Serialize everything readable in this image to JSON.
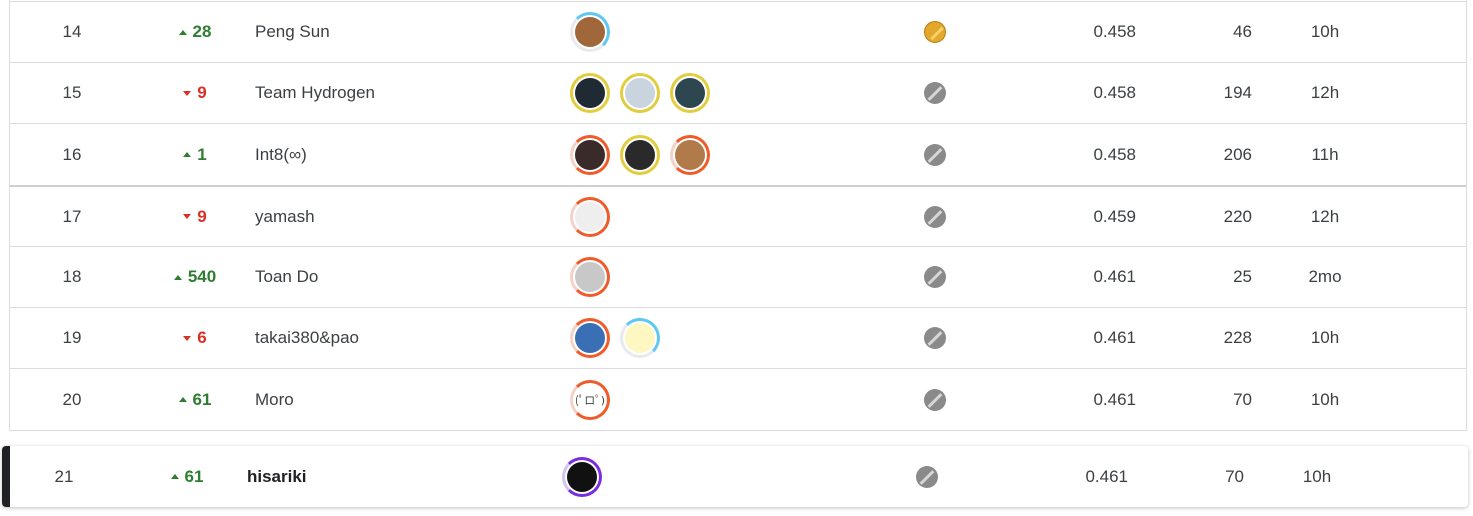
{
  "rows": [
    {
      "rank": "14",
      "dir": "up",
      "delta": "28",
      "name": "Peng Sun",
      "medal": "gold",
      "score": "0.458",
      "entries": "46",
      "last": "10h",
      "avatars": [
        {
          "ring": "r-blue",
          "fill": "#a0683a",
          "name": "avatar-peng-sun"
        }
      ]
    },
    {
      "rank": "15",
      "dir": "down",
      "delta": "9",
      "name": "Team Hydrogen",
      "medal": "silver",
      "score": "0.458",
      "entries": "194",
      "last": "12h",
      "avatars": [
        {
          "ring": "r-gold",
          "fill": "#1f2a33"
        },
        {
          "ring": "r-gold",
          "fill": "#c9d4de"
        },
        {
          "ring": "r-gold",
          "fill": "#2d4650"
        }
      ]
    },
    {
      "rank": "16",
      "dir": "up",
      "delta": "1",
      "name": "Int8(∞)",
      "medal": "silver",
      "score": "0.458",
      "entries": "206",
      "last": "11h",
      "avatars": [
        {
          "ring": "r-orange",
          "fill": "#3a2a2a"
        },
        {
          "ring": "r-gold",
          "fill": "#2a2a2a"
        },
        {
          "ring": "r-orange",
          "fill": "#b07a4a"
        }
      ]
    },
    {
      "rank": "17",
      "dir": "down",
      "delta": "9",
      "name": "yamash",
      "medal": "silver",
      "score": "0.459",
      "entries": "220",
      "last": "12h",
      "avatars": [
        {
          "ring": "r-orange",
          "fill": "#eeeeee"
        }
      ]
    },
    {
      "rank": "18",
      "dir": "up",
      "delta": "540",
      "name": "Toan Do",
      "medal": "silver",
      "score": "0.461",
      "entries": "25",
      "last": "2mo",
      "avatars": [
        {
          "ring": "r-orange",
          "fill": "#c8c8c8"
        }
      ]
    },
    {
      "rank": "19",
      "dir": "down",
      "delta": "6",
      "name": "takai380&pao",
      "medal": "silver",
      "score": "0.461",
      "entries": "228",
      "last": "10h",
      "avatars": [
        {
          "ring": "r-orange",
          "fill": "#3b6fb5"
        },
        {
          "ring": "r-blue",
          "fill": "#fff7c2"
        }
      ]
    },
    {
      "rank": "20",
      "dir": "up",
      "delta": "61",
      "name": "Moro",
      "medal": "silver",
      "score": "0.461",
      "entries": "70",
      "last": "10h",
      "avatars": [
        {
          "ring": "r-orange",
          "fill": "#ffffff",
          "text": "(ﾟロﾟ)"
        }
      ]
    }
  ],
  "own_row": {
    "rank": "21",
    "dir": "up",
    "delta": "61",
    "name": "hisariki",
    "medal": "silver",
    "score": "0.461",
    "entries": "70",
    "last": "10h",
    "avatars": [
      {
        "ring": "r-purple",
        "fill": "#111111"
      }
    ]
  }
}
